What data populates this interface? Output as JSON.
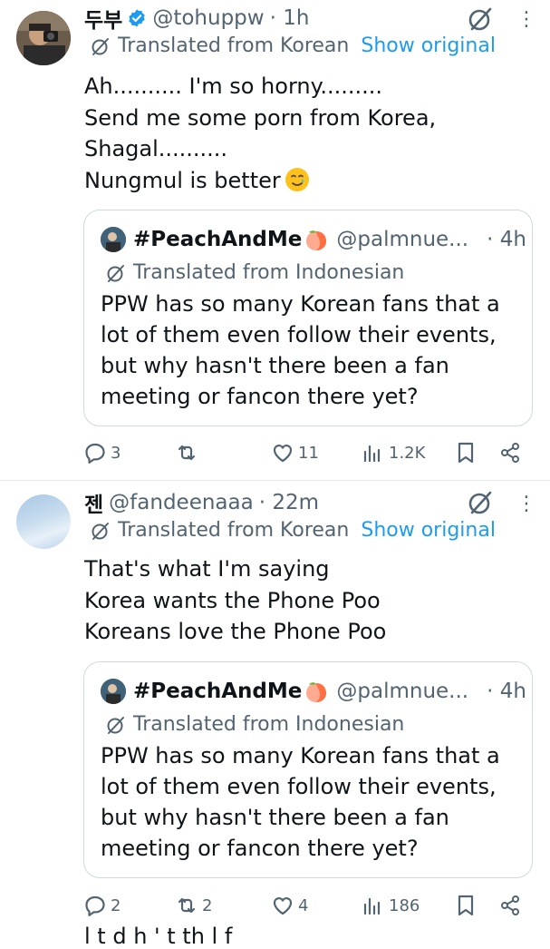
{
  "tweets": [
    {
      "author_name": "두부",
      "handle": "@tohuppw",
      "time": "· 1h",
      "translated_label": "Translated from Korean",
      "show_original": "Show original",
      "text_lines": [
        "Ah.......... I'm so horny.........",
        "Send me some porn from Korea,",
        "Shagal..........",
        "Nungmul is better"
      ],
      "quote": {
        "name": "#PeachAndMe",
        "handle": "@palmnue...",
        "time": "· 4h",
        "translated_label": "Translated from Indonesian",
        "text_lines": [
          "PPW has so many Korean fans that a",
          "lot of them even follow their events,",
          "but why hasn't there been a fan",
          "meeting or fancon there yet?"
        ]
      },
      "actions": {
        "replies": "3",
        "reposts": "",
        "likes": "11",
        "views": "1.2K"
      }
    },
    {
      "author_name": "젠",
      "handle": "@fandeenaaa",
      "time": "· 22m",
      "translated_label": "Translated from Korean",
      "show_original": "Show original",
      "text_lines": [
        "That's what I'm saying",
        "Korea wants the Phone Poo",
        "Koreans love the Phone Poo"
      ],
      "quote": {
        "name": "#PeachAndMe",
        "handle": "@palmnue...",
        "time": "· 4h",
        "translated_label": "Translated from Indonesian",
        "text_lines": [
          "PPW has so many Korean fans that a",
          "lot of them even follow their events,",
          "but why hasn't there been a fan",
          "meeting or fancon there yet?"
        ]
      },
      "actions": {
        "replies": "2",
        "reposts": "2",
        "likes": "4",
        "views": "186"
      }
    }
  ],
  "cutoff_text": "l    t   d   h   ' t  th    l    f",
  "colors": {
    "accent": "#1d9bf0",
    "secondary_text": "#536471",
    "primary_text": "#0f1419",
    "border": "#cfd9de"
  },
  "icons": [
    "verified-badge-icon",
    "grok-icon",
    "more-icon",
    "translate-icon",
    "reply-icon",
    "repost-icon",
    "like-icon",
    "views-icon",
    "bookmark-icon",
    "share-icon"
  ]
}
